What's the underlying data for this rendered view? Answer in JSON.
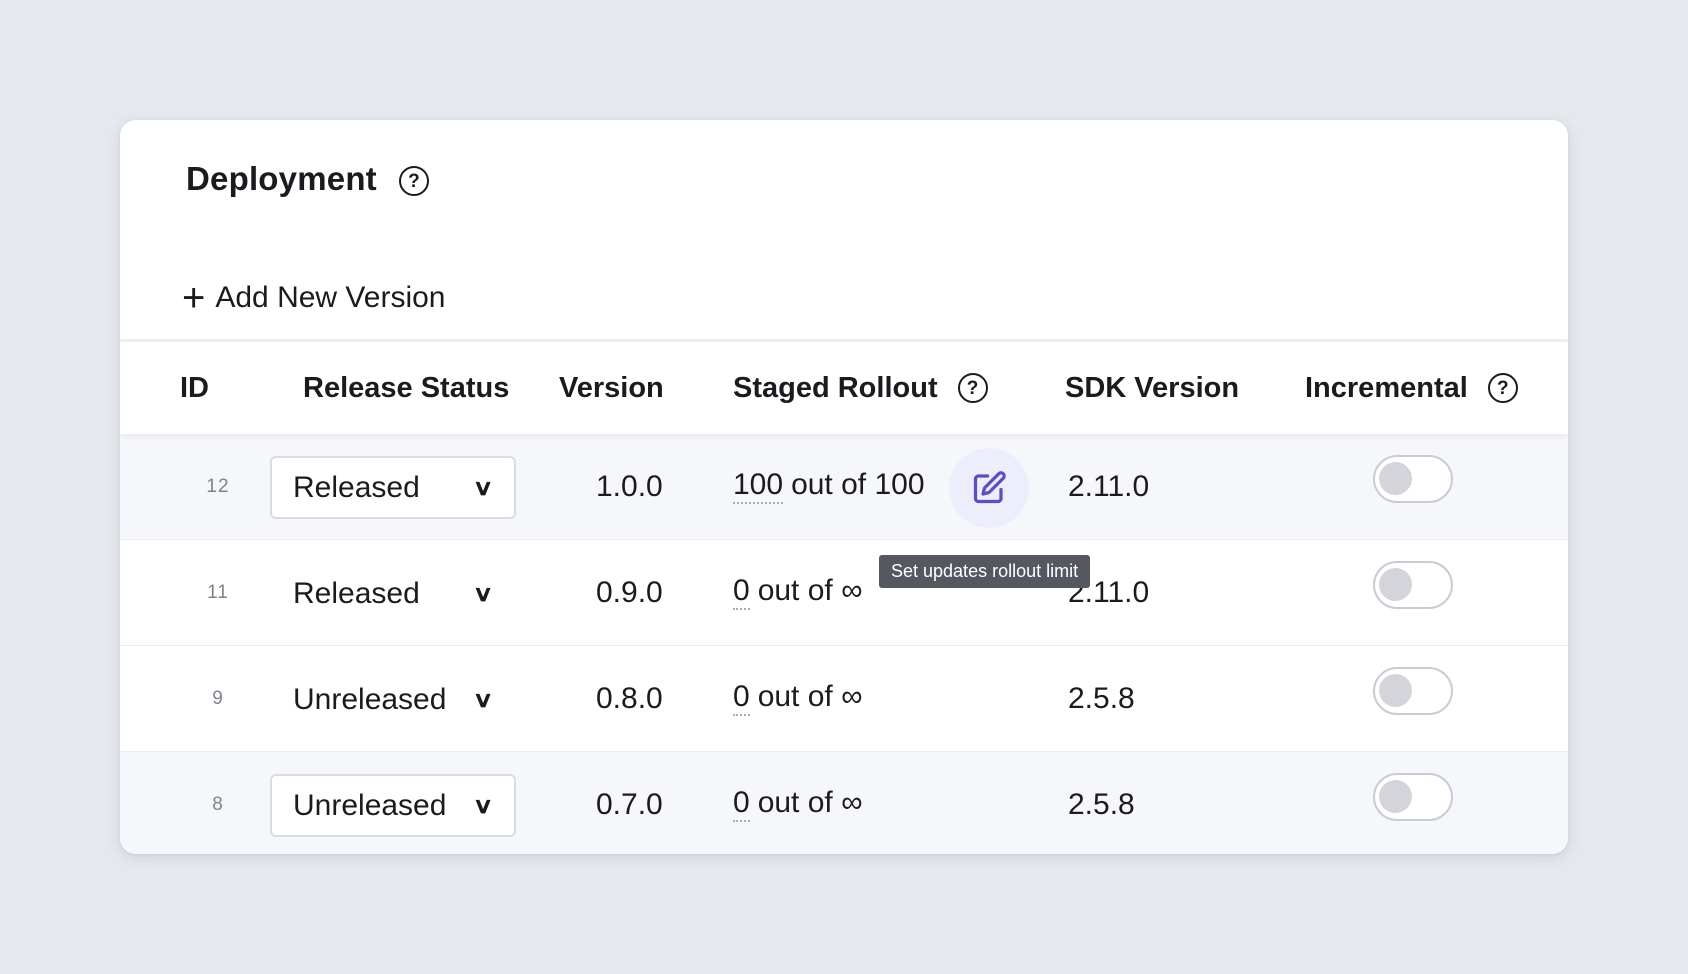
{
  "header": {
    "title": "Deployment",
    "help_icon": "question-circle-icon"
  },
  "add_version": {
    "label": "Add New Version",
    "icon": "plus-icon"
  },
  "columns": {
    "id": "ID",
    "release_status": "Release Status",
    "version": "Version",
    "staged_rollout": "Staged Rollout",
    "sdk_version": "SDK Version",
    "incremental": "Incremental"
  },
  "rows": [
    {
      "id": "12",
      "release_status": "Released",
      "version": "1.0.0",
      "rollout_count": "100",
      "rollout_rest": "out of 100",
      "sdk_version": "2.11.0",
      "incremental": false
    },
    {
      "id": "11",
      "release_status": "Released",
      "version": "0.9.0",
      "rollout_count": "0",
      "rollout_rest": "out of ∞",
      "sdk_version": "2.11.0",
      "incremental": false
    },
    {
      "id": "9",
      "release_status": "Unreleased",
      "version": "0.8.0",
      "rollout_count": "0",
      "rollout_rest": "out of ∞",
      "sdk_version": "2.5.8",
      "incremental": false
    },
    {
      "id": "8",
      "release_status": "Unreleased",
      "version": "0.7.0",
      "rollout_count": "0",
      "rollout_rest": "out of ∞",
      "sdk_version": "2.5.8",
      "incremental": false
    }
  ],
  "tooltip": {
    "text": "Set updates rollout limit"
  },
  "colors": {
    "accent": "#5b4fc4",
    "page_bg": "#e5e8ed",
    "edit_bg": "#eceefb",
    "tooltip_bg": "#55585f"
  }
}
